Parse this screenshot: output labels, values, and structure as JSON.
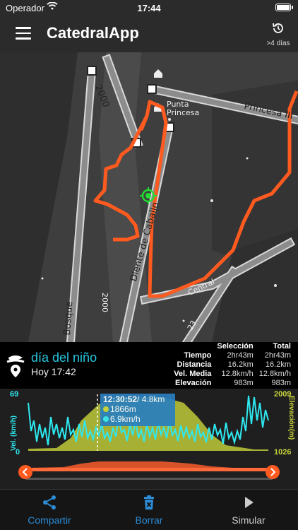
{
  "status": {
    "carrier": "Operador",
    "time": "17:44"
  },
  "nav": {
    "title": "CatedralApp",
    "history_label": ">4 días"
  },
  "map": {
    "labels": {
      "road_2000_top": "2000",
      "punta_princesa": "Punta\nPrincesa",
      "princesa": "Princesa III",
      "diente": "Diente de Caballo",
      "road_2000_low": "2000",
      "bosque": "Bosque",
      "central": "Central",
      "road_23": "23"
    },
    "colors": {
      "track": "#ff5a1f",
      "marker": "#22dd33"
    }
  },
  "info": {
    "route_name": "día del niño",
    "route_date": "Hoy 17:42",
    "headers": {
      "selection": "Selección",
      "total": "Total"
    },
    "rows": [
      {
        "label": "Tiempo",
        "selection": "2hr43m",
        "total": "2hr43m"
      },
      {
        "label": "Distancia",
        "selection": "16.2km",
        "total": "16.2km"
      },
      {
        "label": "Vel. Media",
        "selection": "12.8km/h",
        "total": "12.8km/h"
      },
      {
        "label": "Elevación",
        "selection": "983m",
        "total": "983m"
      }
    ]
  },
  "chart": {
    "speed_axis_label": "Vel. (km/h)",
    "speed_max": "69",
    "speed_min": "0",
    "elev_axis_label": "Elevación(m)",
    "elev_max": "2009",
    "elev_min": "1026",
    "tooltip": {
      "time": "12:30:52",
      "distance": "/ 4.8km",
      "elevation": "1866m",
      "speed": "6.9km/h"
    },
    "colors": {
      "speed": "#2ee8f0",
      "elevation": "#c8d43a"
    }
  },
  "toolbar": {
    "share": "Compartir",
    "delete": "Borrar",
    "simulate": "Simular"
  }
}
